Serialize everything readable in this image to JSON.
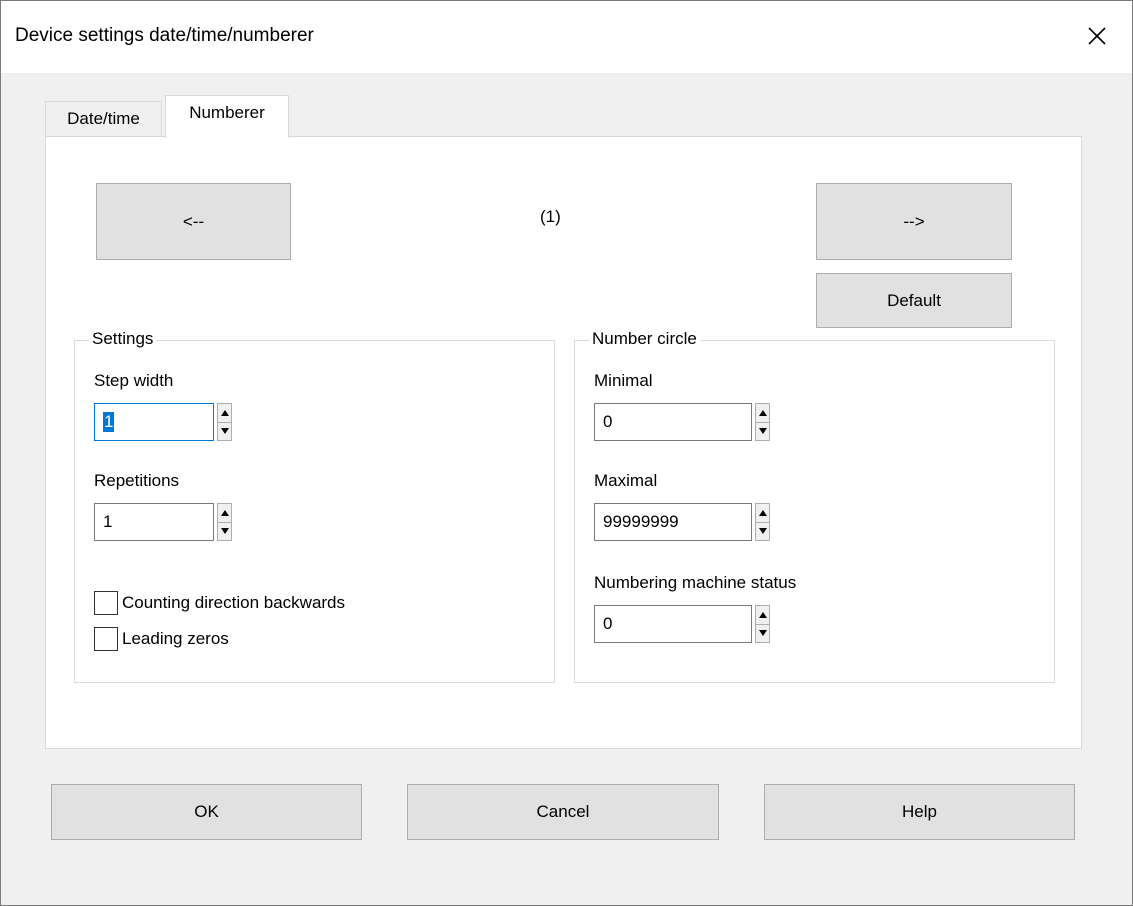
{
  "window": {
    "title": "Device settings date/time/numberer"
  },
  "tabs": [
    {
      "label": "Date/time",
      "active": false
    },
    {
      "label": "Numberer",
      "active": true
    }
  ],
  "nav": {
    "prev_label": "<--",
    "next_label": "-->",
    "page_indicator": "(1)",
    "default_label": "Default"
  },
  "settings": {
    "title": "Settings",
    "step_width": {
      "label": "Step width",
      "value": "1"
    },
    "repetitions": {
      "label": "Repetitions",
      "value": "1"
    },
    "counting_backwards": {
      "label": "Counting direction backwards",
      "checked": false
    },
    "leading_zeros": {
      "label": "Leading zeros",
      "checked": false
    }
  },
  "number_circle": {
    "title": "Number circle",
    "minimal": {
      "label": "Minimal",
      "value": "0"
    },
    "maximal": {
      "label": "Maximal",
      "value": "99999999"
    },
    "machine_status": {
      "label": "Numbering machine status",
      "value": "0"
    }
  },
  "footer": {
    "ok_label": "OK",
    "cancel_label": "Cancel",
    "help_label": "Help"
  },
  "colors": {
    "focus": "#0078d7",
    "button_face": "#e1e1e1",
    "window_bg": "#f0f0f0"
  }
}
